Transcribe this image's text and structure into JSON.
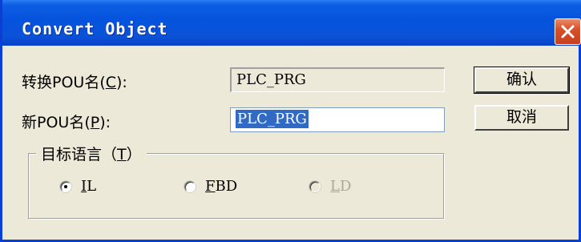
{
  "window": {
    "title": "Convert Object"
  },
  "form": {
    "source_pou_label_prefix": "转换POU名(",
    "source_pou_label_hotkey": "C",
    "source_pou_label_suffix": "):",
    "source_pou_value": "PLC_PRG",
    "new_pou_label_prefix": "新POU名(",
    "new_pou_label_hotkey": "P",
    "new_pou_label_suffix": "):",
    "new_pou_value": "PLC_PRG"
  },
  "buttons": {
    "ok_label": "确认",
    "cancel_label": "取消"
  },
  "language_group": {
    "title_prefix": "目标语言（",
    "title_hotkey": "T",
    "title_suffix": "）",
    "options": [
      {
        "hotkey": "I",
        "rest": "L",
        "checked": true,
        "enabled": true
      },
      {
        "hotkey": "F",
        "rest": "BD",
        "checked": false,
        "enabled": true
      },
      {
        "hotkey": "L",
        "rest": "D",
        "checked": false,
        "enabled": false
      }
    ]
  },
  "colors": {
    "titlebar": "#0553DD",
    "selection": "#316AC5",
    "dialog_bg": "#ECE9D8",
    "close_button": "#D9502A"
  }
}
